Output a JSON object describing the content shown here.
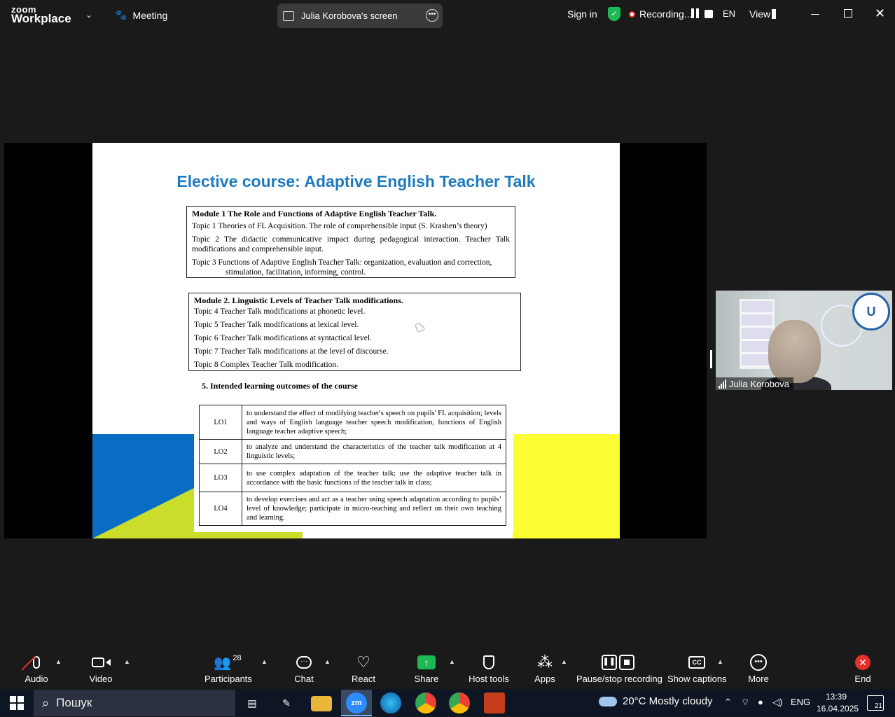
{
  "app": {
    "brand_top": "zoom",
    "brand_bottom": "Workplace",
    "meeting_label": "Meeting"
  },
  "share_pill": {
    "label": "Julia Korobova's screen"
  },
  "header": {
    "sign_in": "Sign in",
    "recording": "Recording...",
    "language": "EN",
    "view": "View"
  },
  "slide": {
    "title": "Elective course: Adaptive English Teacher Talk",
    "module1": {
      "heading": "Module 1 The Role and Functions of Adaptive English Teacher Talk.",
      "topics": [
        "Topic 1 Theories of FL Acquisition. The role of comprehensible input (S. Krashen’s theory)",
        "Topic 2 The didactic communicative impact during pedagogical interaction. Teacher Talk modifications and comprehensible input.",
        "Topic 3 Functions of Adaptive English Teacher Talk: organization, evaluation and correction,",
        "stimulation, facilitation, informing, control."
      ]
    },
    "module2": {
      "heading": "Module 2. Linguistic Levels of Teacher Talk modifications.",
      "topics": [
        "Topic 4 Teacher Talk modifications at phonetic level.",
        "Topic 5 Teacher Talk modifications at lexical level.",
        "Topic 6 Teacher Talk modifications at syntactical level.",
        "Topic 7 Teacher Talk modifications at the level of discourse.",
        "Topic 8 Complex Teacher Talk modification."
      ]
    },
    "outcomes_title": "5. Intended learning outcomes of the course",
    "outcomes": [
      {
        "code": "LO1",
        "text": "to understand the effect of modifying teacher's speech on pupils' FL acquisition; levels and ways of English language teacher speech modification, functions of English language teacher adaptive speech;"
      },
      {
        "code": "LO2",
        "text": "to analyze and understand the characteristics of the teacher talk modification at 4 linguistic levels;"
      },
      {
        "code": "LO3",
        "text": "to use complex adaptation of the teacher talk; use the adaptive teacher talk in accordance with the basic functions of the teacher talk in class;"
      },
      {
        "code": "LO4",
        "text": "to develop exercises and act as a teacher using speech adaptation according to pupils’ level of knowledge; participate in micro-teaching and reflect on their own teaching and learning."
      }
    ]
  },
  "video": {
    "participant_name": "Julia Korobova",
    "logo_text": "U"
  },
  "toolbar": {
    "audio": "Audio",
    "video": "Video",
    "participants": "Participants",
    "participant_count": "28",
    "chat": "Chat",
    "react": "React",
    "share": "Share",
    "host_tools": "Host tools",
    "apps": "Apps",
    "pause_stop": "Pause/stop recording",
    "captions": "Show captions",
    "captions_icon": "CC",
    "more": "More",
    "end": "End"
  },
  "taskbar": {
    "search_placeholder": "Пошук",
    "zoom_icon": "zm",
    "weather": "20°C  Mostly cloudy",
    "input_lang": "ENG",
    "time": "13:39",
    "date": "16.04.2025",
    "notifications": "21"
  },
  "colors": {
    "title_blue": "#1f7bc0",
    "accent_green": "#1db954",
    "end_red": "#e5312c"
  }
}
